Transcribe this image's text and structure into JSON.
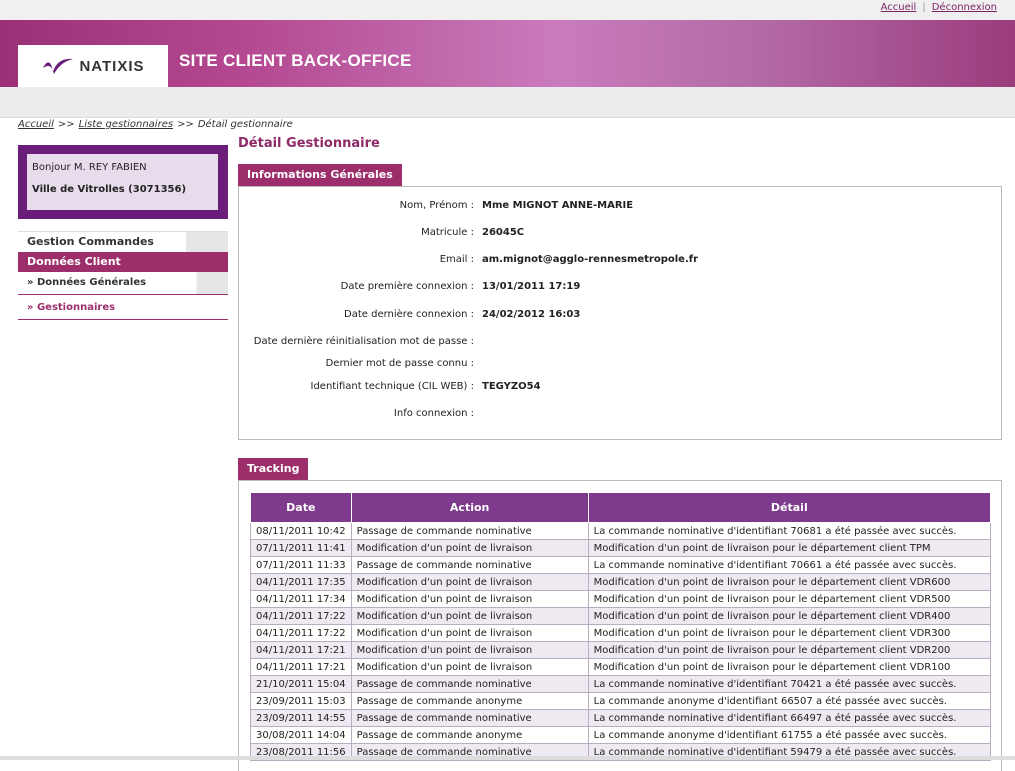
{
  "top_links": {
    "home": "Accueil",
    "separator": "|",
    "logout": "Déconnexion"
  },
  "banner": {
    "logo_text": "NATIXIS",
    "title": "SITE CLIENT BACK-OFFICE"
  },
  "breadcrumb": {
    "home": "Accueil",
    "sep1": ">>",
    "list": "Liste gestionnaires",
    "sep2": ">>",
    "current": "Détail gestionnaire"
  },
  "user": {
    "greeting": "Bonjour M. REY FABIEN",
    "company": "Ville de Vitrolles (3071356)"
  },
  "menu": {
    "gestion_commandes": "Gestion Commandes",
    "donnees_client": "Données Client",
    "donnees_generales": "Données Générales",
    "gestionnaires": "Gestionnaires",
    "bullet": "»"
  },
  "page_title": "Détail Gestionnaire",
  "info": {
    "section_title": "Informations Générales",
    "rows": [
      {
        "label": "Nom, Prénom :",
        "value": "Mme MIGNOT ANNE-MARIE"
      },
      {
        "label": "Matricule :",
        "value": "26045C"
      },
      {
        "label": "Email :",
        "value": "am.mignot@agglo-rennesmetropole.fr"
      },
      {
        "label": "Date première connexion :",
        "value": "13/01/2011 17:19"
      },
      {
        "label": "Date dernière connexion :",
        "value": "24/02/2012 16:03"
      },
      {
        "label": "Date dernière réinitialisation mot de passe :",
        "value": ""
      },
      {
        "label": "Dernier mot de passe connu :",
        "value": ""
      },
      {
        "label": "Identifiant technique (CIL WEB) :",
        "value": "TEGYZO54"
      },
      {
        "label": "Info connexion :",
        "value": ""
      }
    ]
  },
  "tracking": {
    "section_title": "Tracking",
    "columns": [
      "Date",
      "Action",
      "Détail"
    ],
    "rows": [
      [
        "08/11/2011 10:42",
        "Passage de commande nominative",
        "La commande nominative d'identifiant 70681 a été passée avec succès."
      ],
      [
        "07/11/2011 11:41",
        "Modification d'un point de livraison",
        "Modification d'un point de livraison pour le département client TPM"
      ],
      [
        "07/11/2011 11:33",
        "Passage de commande nominative",
        "La commande nominative d'identifiant 70661 a été passée avec succès."
      ],
      [
        "04/11/2011 17:35",
        "Modification d'un point de livraison",
        "Modification d'un point de livraison pour le département client VDR600"
      ],
      [
        "04/11/2011 17:34",
        "Modification d'un point de livraison",
        "Modification d'un point de livraison pour le département client VDR500"
      ],
      [
        "04/11/2011 17:22",
        "Modification d'un point de livraison",
        "Modification d'un point de livraison pour le département client VDR400"
      ],
      [
        "04/11/2011 17:22",
        "Modification d'un point de livraison",
        "Modification d'un point de livraison pour le département client VDR300"
      ],
      [
        "04/11/2011 17:21",
        "Modification d'un point de livraison",
        "Modification d'un point de livraison pour le département client VDR200"
      ],
      [
        "04/11/2011 17:21",
        "Modification d'un point de livraison",
        "Modification d'un point de livraison pour le département client VDR100"
      ],
      [
        "21/10/2011 15:04",
        "Passage de commande nominative",
        "La commande nominative d'identifiant 70421 a été passée avec succès."
      ],
      [
        "23/09/2011 15:03",
        "Passage de commande anonyme",
        "La commande anonyme d'identifiant 66507 a été passée avec succès."
      ],
      [
        "23/09/2011 14:55",
        "Passage de commande nominative",
        "La commande nominative d'identifiant 66497 a été passée avec succès."
      ],
      [
        "30/08/2011 14:04",
        "Passage de commande anonyme",
        "La commande anonyme d'identifiant 61755 a été passée avec succès."
      ],
      [
        "23/08/2011 11:56",
        "Passage de commande nominative",
        "La commande nominative d'identifiant 59479 a été passée avec succès."
      ]
    ]
  },
  "colors": {
    "brand": "#9c2f6b",
    "table_header": "#7e3a8c",
    "userbox": "#6a1e7a"
  }
}
